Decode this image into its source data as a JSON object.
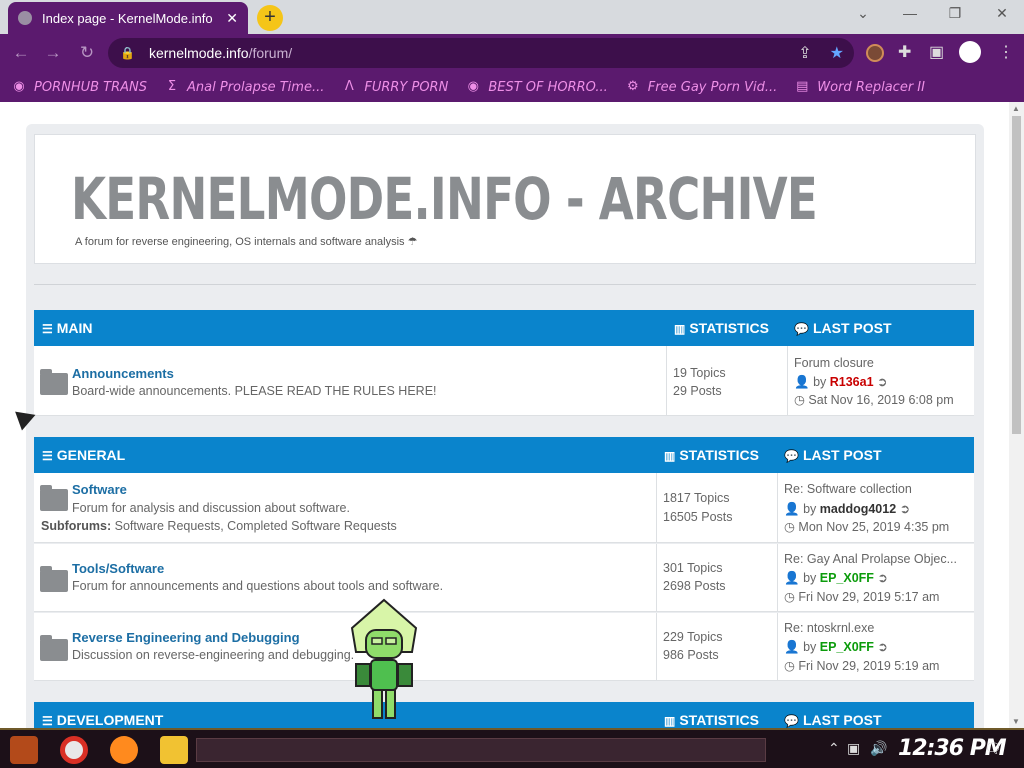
{
  "browser": {
    "tab_title": "Index page - KernelMode.info",
    "url_host": "kernelmode.info",
    "url_path": "/forum/",
    "bookmarks": [
      {
        "label": "PORNHUB TRANS",
        "icon": "globe-icon"
      },
      {
        "label": "Anal Prolapse Time...",
        "icon": "sigma-icon"
      },
      {
        "label": "FURRY PORN",
        "icon": "lambda-icon"
      },
      {
        "label": "BEST OF HORRO...",
        "icon": "globe-icon"
      },
      {
        "label": "Free Gay Porn Vid...",
        "icon": "gear-icon"
      },
      {
        "label": "Word Replacer II",
        "icon": "wr-icon"
      }
    ],
    "accent": "#5b1a6e"
  },
  "site": {
    "title": "KERNELMODE.INFO - ARCHIVE",
    "tagline": "A forum for reverse engineering, OS internals and software analysis"
  },
  "columns": {
    "statistics": "STATISTICS",
    "last_post": "LAST POST"
  },
  "categories": {
    "main": {
      "name": "MAIN",
      "forums": [
        {
          "title": "Announcements",
          "desc": "Board-wide announcements. PLEASE READ THE RULES HERE!",
          "topics": "19 Topics",
          "posts": "29 Posts",
          "last_title": "Forum closure",
          "by": "by",
          "last_user": "R136a1",
          "last_date": "Sat Nov 16, 2019 6:08 pm"
        }
      ]
    },
    "general": {
      "name": "GENERAL",
      "forums": [
        {
          "title": "Software",
          "desc": "Forum for analysis and discussion about software.",
          "subforums_label": "Subforums:",
          "subforums": "Software Requests, Completed Software Requests",
          "topics": "1817 Topics",
          "posts": "16505 Posts",
          "last_title": "Re: Software collection",
          "by": "by",
          "last_user": "maddog4012",
          "last_date": "Mon Nov 25, 2019 4:35 pm"
        },
        {
          "title": "Tools/Software",
          "desc": "Forum for announcements and questions about tools and software.",
          "topics": "301 Topics",
          "posts": "2698 Posts",
          "last_title": "Re: Gay Anal Prolapse Objec...",
          "by": "by",
          "last_user": "EP_X0FF",
          "last_date": "Fri Nov 29, 2019 5:17 am"
        },
        {
          "title": "Reverse Engineering and Debugging",
          "desc": "Discussion on reverse-engineering and debugging.",
          "topics": "229 Topics",
          "posts": "986 Posts",
          "last_title": "Re: ntoskrnl.exe",
          "by": "by",
          "last_user": "EP_X0FF",
          "last_date": "Fri Nov 29, 2019 5:19 am"
        }
      ]
    },
    "development": {
      "name": "DEVELOPMENT"
    }
  },
  "taskbar": {
    "clock": "12:36 PM"
  }
}
